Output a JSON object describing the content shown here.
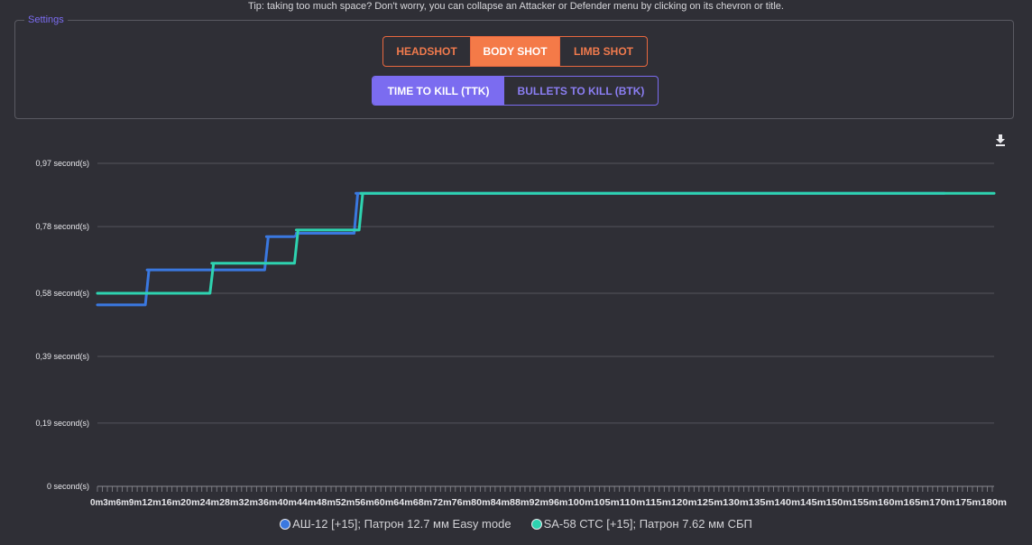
{
  "tip": "Tip: taking too much space? Don't worry, you can collapse an Attacker or Defender menu by clicking on its chevron or title.",
  "settings": {
    "legend": "Settings",
    "shot_buttons": [
      "HEADSHOT",
      "BODY SHOT",
      "LIMB SHOT"
    ],
    "shot_active": "BODY SHOT",
    "mode_buttons": [
      "TIME TO KILL (TTK)",
      "BULLETS TO KILL (BTK)"
    ],
    "mode_active": "TIME TO KILL (TTK)"
  },
  "icons": {
    "download": "download-icon"
  },
  "colors": {
    "background": "#2f2f36",
    "shot_accent": "#f47a48",
    "mode_accent": "#7b6cf0",
    "series1": "#3a78e0",
    "series2": "#2ed3b0",
    "grid": "#55555c"
  },
  "chart_data": {
    "type": "line",
    "step": true,
    "ylabel": "",
    "xlabel": "",
    "ylim": [
      0,
      0.97
    ],
    "y_ticks": [
      {
        "value": 0,
        "label": "0 second(s)"
      },
      {
        "value": 0.19,
        "label": "0,19 second(s)"
      },
      {
        "value": 0.39,
        "label": "0,39 second(s)"
      },
      {
        "value": 0.58,
        "label": "0,58 second(s)"
      },
      {
        "value": 0.78,
        "label": "0,78 second(s)"
      },
      {
        "value": 0.97,
        "label": "0,97 second(s)"
      }
    ],
    "x_tick_labels": [
      "0m",
      "3m",
      "6m",
      "9m",
      "12m",
      "16m",
      "20m",
      "24m",
      "28m",
      "32m",
      "36m",
      "40m",
      "44m",
      "48m",
      "52m",
      "56m",
      "60m",
      "64m",
      "68m",
      "72m",
      "76m",
      "80m",
      "84m",
      "88m",
      "92m",
      "96m",
      "100m",
      "105m",
      "110m",
      "115m",
      "120m",
      "125m",
      "130m",
      "135m",
      "140m",
      "145m",
      "150m",
      "155m",
      "160m",
      "165m",
      "170m",
      "175m",
      "180m"
    ],
    "grid": true,
    "legend_position": "bottom",
    "series": [
      {
        "name": "АШ-12 [+15]; Патрон 12.7 мм Easy mode",
        "color": "#3a78e0",
        "steps": [
          [
            0,
            0.545
          ],
          [
            10,
            0.65
          ],
          [
            34,
            0.75
          ],
          [
            40,
            0.76
          ],
          [
            52,
            0.88
          ],
          [
            170,
            0.88
          ]
        ]
      },
      {
        "name": "SA-58 СТС [+15]; Патрон 7.62 мм СБП",
        "color": "#2ed3b0",
        "steps": [
          [
            0,
            0.58
          ],
          [
            23,
            0.67
          ],
          [
            40,
            0.77
          ],
          [
            53,
            0.88
          ],
          [
            180,
            0.88
          ]
        ]
      }
    ]
  }
}
